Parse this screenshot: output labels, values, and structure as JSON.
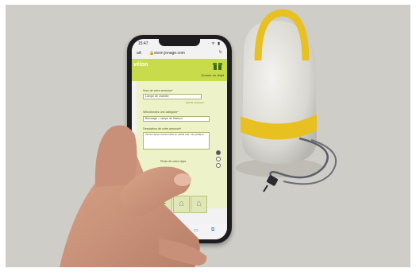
{
  "phone": {
    "status_time": "15:47",
    "status_icons": "ᐧ ᯤ ▮",
    "url": "sivon.jonage.com",
    "reader_label": "aA",
    "reload_icon": "reload-icon"
  },
  "site": {
    "logo": "vélon",
    "logo_sub": "",
    "header_cta": "Donner un objet"
  },
  "form": {
    "name_label": "Nom de votre annonce*",
    "name_value": "Lampe de chantier",
    "name_hint": "Max 50 caractères",
    "category_label": "Sélectionnez une catégorie*",
    "category_value": "Bricolage - Lampe de Maison",
    "description_label": "Description de votre annonce*",
    "description_value": "Vends Lampe fonctionnelle en parfait état, très pratique...",
    "photo_label": "Photo de votre objet"
  },
  "colors": {
    "site_green": "#c8db4a",
    "lamp_yellow": "#e8c020",
    "phone_body": "#1d1d1f"
  }
}
